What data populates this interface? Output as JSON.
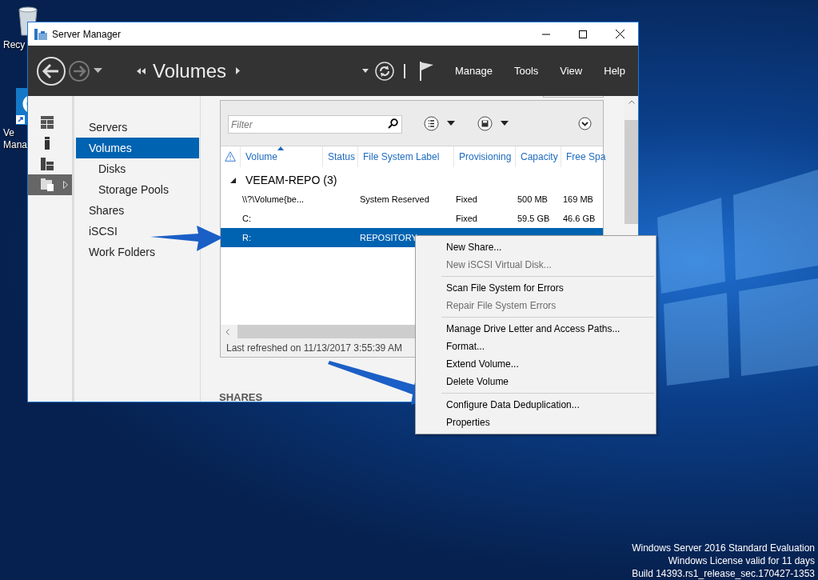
{
  "desktop": {
    "icons": [
      {
        "label": "Recy",
        "kind": "bin"
      },
      {
        "label": "Ve\nMana",
        "kind": "app"
      }
    ],
    "watermark_lines": [
      "Windows Server 2016 Standard Evaluation",
      "Windows License valid for 11 days",
      "Build 14393.rs1_release_sec.170427-1353"
    ]
  },
  "window": {
    "title": "Server Manager",
    "breadcrumb": "Volumes",
    "menu": [
      "Manage",
      "Tools",
      "View",
      "Help"
    ]
  },
  "rail": [
    {
      "kind": "dashboard",
      "selected": false
    },
    {
      "kind": "server",
      "selected": false
    },
    {
      "kind": "all",
      "selected": false
    },
    {
      "kind": "files",
      "selected": true
    }
  ],
  "sidebar": {
    "items": [
      {
        "label": "Servers",
        "selected": false
      },
      {
        "label": "Volumes",
        "selected": true,
        "children": [
          {
            "label": "Disks",
            "selected": false
          },
          {
            "label": "Storage Pools",
            "selected": false
          }
        ]
      },
      {
        "label": "Shares",
        "selected": false
      },
      {
        "label": "iSCSI",
        "selected": false
      },
      {
        "label": "Work Folders",
        "selected": false
      }
    ]
  },
  "volumes": {
    "filter": {
      "placeholder": "Filter"
    },
    "columns": [
      "Volume",
      "Status",
      "File System Label",
      "Provisioning",
      "Capacity",
      "Free Spa"
    ],
    "group": {
      "label": "VEEAM-REPO (3)",
      "expanded": true
    },
    "rows": [
      {
        "cells": [
          "\\\\?\\Volume{be...",
          "",
          "System Reserved",
          "Fixed",
          "500 MB",
          "169 MB"
        ],
        "selected": false
      },
      {
        "cells": [
          "C:",
          "",
          "",
          "Fixed",
          "59.5 GB",
          "46.6 GB"
        ],
        "selected": false
      },
      {
        "cells": [
          "R:",
          "",
          "REPOSITORY",
          "",
          "",
          ""
        ],
        "selected": true
      }
    ],
    "status": "Last refreshed on 11/13/2017 3:55:39 AM"
  },
  "shares_heading": "SHARES",
  "context_menu": {
    "groups": [
      [
        {
          "label": "New Share...",
          "disabled": false
        },
        {
          "label": "New iSCSI Virtual Disk...",
          "disabled": true
        }
      ],
      [
        {
          "label": "Scan File System for Errors",
          "disabled": false
        },
        {
          "label": "Repair File System Errors",
          "disabled": true
        }
      ],
      [
        {
          "label": "Manage Drive Letter and Access Paths...",
          "disabled": false
        },
        {
          "label": "Format...",
          "disabled": false
        },
        {
          "label": "Extend Volume...",
          "disabled": false
        },
        {
          "label": "Delete Volume",
          "disabled": false
        }
      ],
      [
        {
          "label": "Configure Data Deduplication...",
          "disabled": false
        },
        {
          "label": "Properties",
          "disabled": false
        }
      ]
    ]
  }
}
